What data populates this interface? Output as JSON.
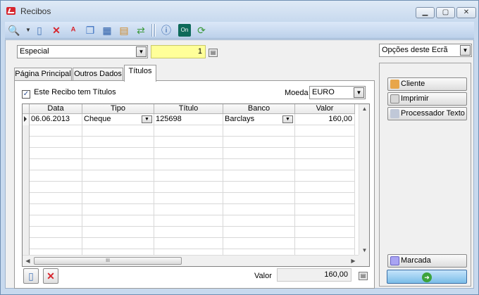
{
  "window": {
    "title": "Recibos",
    "minimize": "▁",
    "maximize": "▢",
    "close": "✕"
  },
  "toolbar": {
    "icons": [
      "magnifier-icon",
      "new-doc-icon",
      "delete-icon",
      "text-icon",
      "copy-icon",
      "grid-icon",
      "print-icon",
      "refresh-icon",
      "help-icon",
      "toggle-icon",
      "sync-icon"
    ]
  },
  "header": {
    "type_select": "Especial",
    "number": "1"
  },
  "tabs": [
    "Página Principal",
    "Outros Dados",
    "Títulos"
  ],
  "titulos": {
    "checkbox_label": "Este Recibo tem Títulos",
    "checkbox_checked": "✓",
    "moeda_label": "Moeda",
    "moeda_value": "EURO",
    "columns": [
      "Data",
      "Tipo",
      "Título",
      "Banco",
      "Valor"
    ],
    "rows": [
      {
        "data": "06.06.2013",
        "tipo": "Cheque",
        "titulo": "125698",
        "banco": "Barclays",
        "valor": "160,00"
      }
    ],
    "scroll_thumb": "III",
    "valor_label": "Valor",
    "valor_total": "160,00"
  },
  "right": {
    "options_select": "Opções deste Ecrã",
    "buttons": [
      "Cliente",
      "Imprimir",
      "Processador Texto"
    ],
    "marcada_label": "Marcada"
  },
  "colors": {
    "yellow_field": "#ffff99",
    "accent_blue": "#7bbde8",
    "brand_red": "#d7262e"
  }
}
